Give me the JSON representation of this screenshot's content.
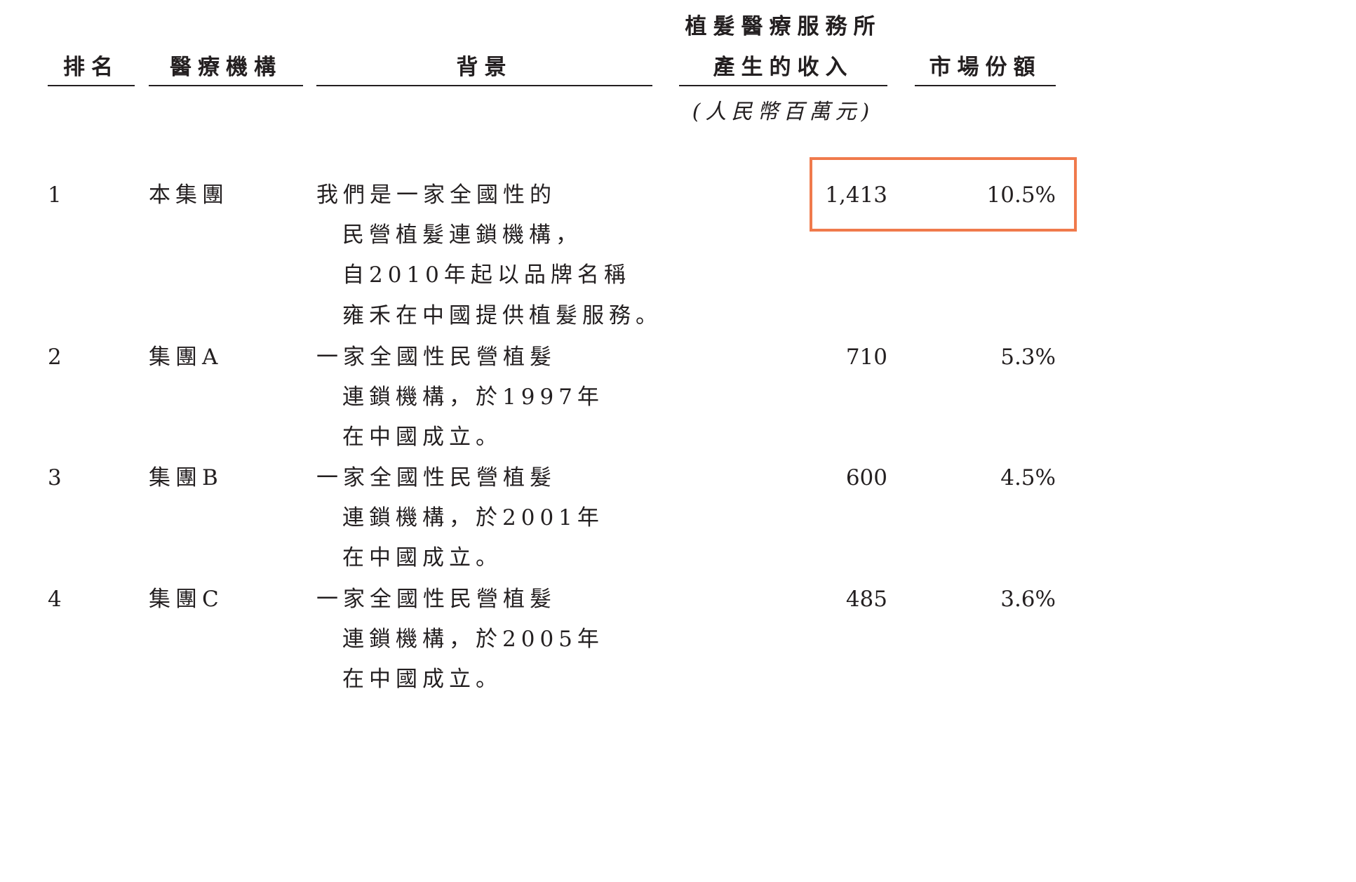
{
  "headers": {
    "rank": "排名",
    "institution": "醫療機構",
    "background": "背景",
    "revenue_line1": "植髮醫療服務所",
    "revenue_line2": "產生的收入",
    "share": "市場份額",
    "revenue_unit": "(人民幣百萬元)"
  },
  "rows": [
    {
      "rank": "1",
      "institution": "本集團",
      "background": [
        "我們是一家全國性的",
        "民營植髮連鎖機構，",
        "自2010年起以品牌名稱",
        "雍禾在中國提供植髮服務。"
      ],
      "revenue": "1,413",
      "share": "10.5%"
    },
    {
      "rank": "2",
      "institution": "集團A",
      "background": [
        "一家全國性民營植髮",
        "連鎖機構，於1997年",
        "在中國成立。"
      ],
      "revenue": "710",
      "share": "5.3%"
    },
    {
      "rank": "3",
      "institution": "集團B",
      "background": [
        "一家全國性民營植髮",
        "連鎖機構，於2001年",
        "在中國成立。"
      ],
      "revenue": "600",
      "share": "4.5%"
    },
    {
      "rank": "4",
      "institution": "集團C",
      "background": [
        "一家全國性民營植髮",
        "連鎖機構，於2005年",
        "在中國成立。"
      ],
      "revenue": "485",
      "share": "3.6%"
    }
  ],
  "highlight": {
    "color": "#f07a4c"
  }
}
